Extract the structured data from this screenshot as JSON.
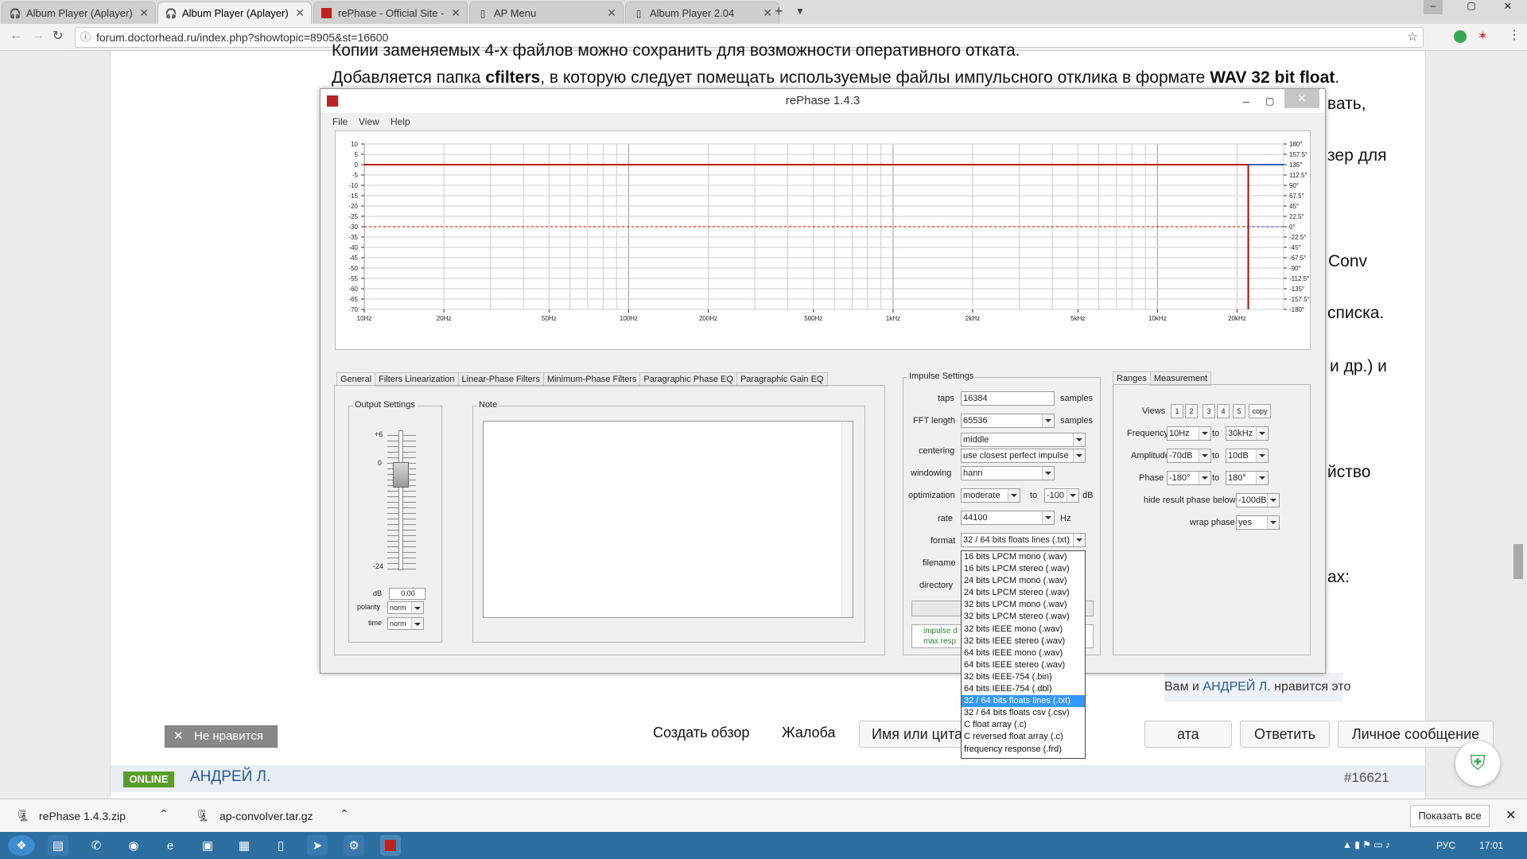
{
  "browser": {
    "tabs": [
      {
        "title": "Album Player (Aplayer)",
        "icon": "headphones-icon"
      },
      {
        "title": "Album Player (Aplayer)",
        "icon": "headphones-icon"
      },
      {
        "title": "rePhase - Official Site -",
        "icon": "rephase-icon"
      },
      {
        "title": "AP Menu",
        "icon": "page-icon"
      },
      {
        "title": "Album Player 2.04",
        "icon": "page-icon"
      }
    ],
    "url": "forum.doctorhead.ru/index.php?showtopic=8905&st=16600"
  },
  "forum": {
    "line_top": "Копии заменяемых 4-х файлов можно сохранить для возможности оперативного отката.",
    "line2_a": "Добавляется папка ",
    "line2_b": "cfilters",
    "line2_c": ", в которую следует помещать используемые файлы импульсного отклика в формате ",
    "line2_d": "WAV 32 bit float",
    "line2_e": ".",
    "side_texts": [
      "вать,",
      "зер для",
      "Conv",
      "списка.",
      "и др.) и",
      "йство",
      "ах:"
    ],
    "likes_prefix": "Вам и ",
    "likes_user": "АНДРЕЙ Л.",
    "likes_suffix": " нравится это",
    "dislike_button": "Не нравится",
    "buttons": [
      "Создать обзор",
      "Жалоба",
      "Имя или цита",
      "ата",
      "Ответить",
      "Личное сообщение"
    ],
    "online_badge": "ONLINE",
    "next_user": "АНДРЕЙ Л.",
    "post_number": "#16621"
  },
  "rephase": {
    "title": "rePhase 1.4.3",
    "menu": [
      "File",
      "View",
      "Help"
    ],
    "tabs": [
      "General",
      "Filters Linearization",
      "Linear-Phase Filters",
      "Minimum-Phase Filters",
      "Paragraphic Phase EQ",
      "Paragraphic Gain EQ"
    ],
    "output_settings": {
      "legend": "Output Settings",
      "top": "+6",
      "mid": "0",
      "bottom": "-24",
      "db_label": "dB",
      "db_value": "0.00",
      "polarity_label": "polarity",
      "polarity": "norm",
      "time_label": "time",
      "time": "norm"
    },
    "note_legend": "Note",
    "impulse": {
      "legend": "Impulse Settings",
      "taps_label": "taps",
      "taps": "16384",
      "taps_unit": "samples",
      "fft_label": "FFT length",
      "fft": "65536",
      "fft_unit": "samples",
      "centering_label": "centering",
      "centering": "middle",
      "centering2": "use closest perfect impulse",
      "windowing_label": "windowing",
      "windowing": "hann",
      "optimization_label": "optimization",
      "optimization": "moderate",
      "opt_to": "to",
      "opt_value": "-100",
      "opt_unit": "dB",
      "rate_label": "rate",
      "rate": "44100",
      "rate_unit": "Hz",
      "format_label": "format",
      "format": "32 / 64 bits floats lines (.txt)",
      "filename_label": "filename",
      "directory_label": "directory",
      "status1": "impulse d",
      "status2": "max resp"
    },
    "format_options": [
      "16 bits LPCM mono (.wav)",
      "16 bits LPCM stereo (.wav)",
      "24 bits LPCM mono (.wav)",
      "24 bits LPCM stereo (.wav)",
      "32 bits LPCM mono (.wav)",
      "32 bits LPCM stereo (.wav)",
      "32 bits IEEE mono (.wav)",
      "32 bits IEEE stereo (.wav)",
      "64 bits IEEE mono (.wav)",
      "64 bits IEEE stereo (.wav)",
      "32 bits IEEE-754 (.bin)",
      "64 bits IEEE-754 (.dbl)",
      "32 / 64 bits floats lines (.txt)",
      "32 / 64 bits floats csv (.csv)",
      "C float array (.c)",
      "C reversed float array (.c)",
      "frequency response (.frd)"
    ],
    "ranges_tabs": [
      "Ranges",
      "Measurement"
    ],
    "ranges": {
      "views_label": "Views",
      "views": [
        "1",
        "2",
        "3",
        "4",
        "5",
        "copy"
      ],
      "frequency_label": "Frequency",
      "freq_from": "10Hz",
      "to": "to",
      "freq_to": "30kHz",
      "amplitude_label": "Amplitude",
      "amp_from": "-70dB",
      "amp_to": "10dB",
      "phase_label": "Phase",
      "phase_from": "-180°",
      "phase_to": "180°",
      "hide_label": "hide result phase below",
      "hide_value": "-100dB",
      "wrap_label": "wrap phase",
      "wrap_value": "yes"
    },
    "chart": {
      "left_ticks": [
        "10",
        "5",
        "0",
        "-5",
        "-10",
        "-15",
        "-20",
        "-25",
        "-30",
        "-35",
        "-40",
        "-45",
        "-50",
        "-55",
        "-60",
        "-65",
        "-70"
      ],
      "right_ticks": [
        "180°",
        "157.5°",
        "135°",
        "112.5°",
        "90°",
        "67.5°",
        "45°",
        "22.5°",
        "0°",
        "-22.5°",
        "-45°",
        "-67.5°",
        "-90°",
        "-112.5°",
        "-135°",
        "-157.5°",
        "-180°"
      ],
      "x_ticks": [
        "10Hz",
        "20Hz",
        "50Hz",
        "100Hz",
        "200Hz",
        "500Hz",
        "1kHz",
        "2kHz",
        "5kHz",
        "10kHz",
        "20kHz"
      ]
    }
  },
  "chart_data": {
    "type": "line",
    "x_scale": "log",
    "x_range": [
      "10Hz",
      "30kHz"
    ],
    "left_axis_range": [
      -70,
      10
    ],
    "right_axis_range": [
      "-180°",
      "180°"
    ],
    "series": [
      {
        "color": "#c00000",
        "style": "solid",
        "values_db": 0,
        "until": "22.05kHz"
      },
      {
        "color": "#c00000",
        "style": "dashed",
        "values_db": -30
      },
      {
        "color": "#2060c0",
        "style": "solid",
        "segment": "above 22.05kHz"
      },
      {
        "color": "#2060c0",
        "style": "dashed",
        "segment": "above 22.05kHz"
      }
    ]
  },
  "downloads": {
    "items": [
      "rePhase 1.4.3.zip",
      "ap-convolver.tar.gz"
    ],
    "show_all": "Показать все"
  },
  "taskbar": {
    "lang": "РУС",
    "time": "17:01"
  }
}
